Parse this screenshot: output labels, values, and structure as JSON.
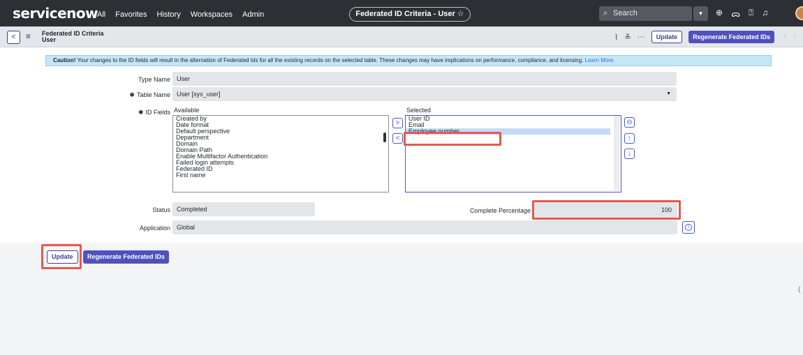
{
  "topnav": {
    "logo": "servicenow",
    "menu": [
      "All",
      "Favorites",
      "History",
      "Workspaces",
      "Admin"
    ],
    "title_pill": "Federated ID Criteria - User",
    "star": "☆",
    "search_placeholder": "Search",
    "icons": [
      "globe-icon",
      "chat-icon",
      "help-icon",
      "bell-icon"
    ]
  },
  "form_header": {
    "title": "Federated ID Criteria",
    "subtitle": "User",
    "update_label": "Update",
    "regenerate_label": "Regenerate Federated IDs"
  },
  "caution": {
    "bold": "Caution!",
    "text": " Your changes to the ID fields will result in the alternation of Federated Ids for all the existing records on the selected table. These changes may have implications on performance, compliance, and licensing. ",
    "link": "Learn More."
  },
  "form": {
    "type_name_label": "Type Name",
    "type_name_value": "User",
    "table_name_label": "Table Name",
    "table_name_value": "User [sys_user]",
    "id_fields_label": "ID Fields",
    "available_label": "Available",
    "selected_label": "Selected",
    "available_options": [
      "Created by",
      "Date format",
      "Default perspective",
      "Department",
      "Domain",
      "Domain Path",
      "Enable Multifactor Authentication",
      "Failed login attempts",
      "Federated ID",
      "First name"
    ],
    "selected_options": [
      "User ID",
      "Email",
      "Employee number"
    ],
    "highlighted_selected": "Employee number",
    "status_label": "Status",
    "status_value": "Completed",
    "complete_percentage_label": "Complete Percentage",
    "complete_percentage_value": "100",
    "application_label": "Application",
    "application_value": "Global"
  },
  "footer_buttons": {
    "update_label": "Update",
    "regenerate_label": "Regenerate Federated IDs"
  },
  "colors": {
    "nav_bg": "#2c2f34",
    "accent": "#4f52bd",
    "highlight": "#e5594f",
    "caution_bg": "#c5e6f7"
  }
}
